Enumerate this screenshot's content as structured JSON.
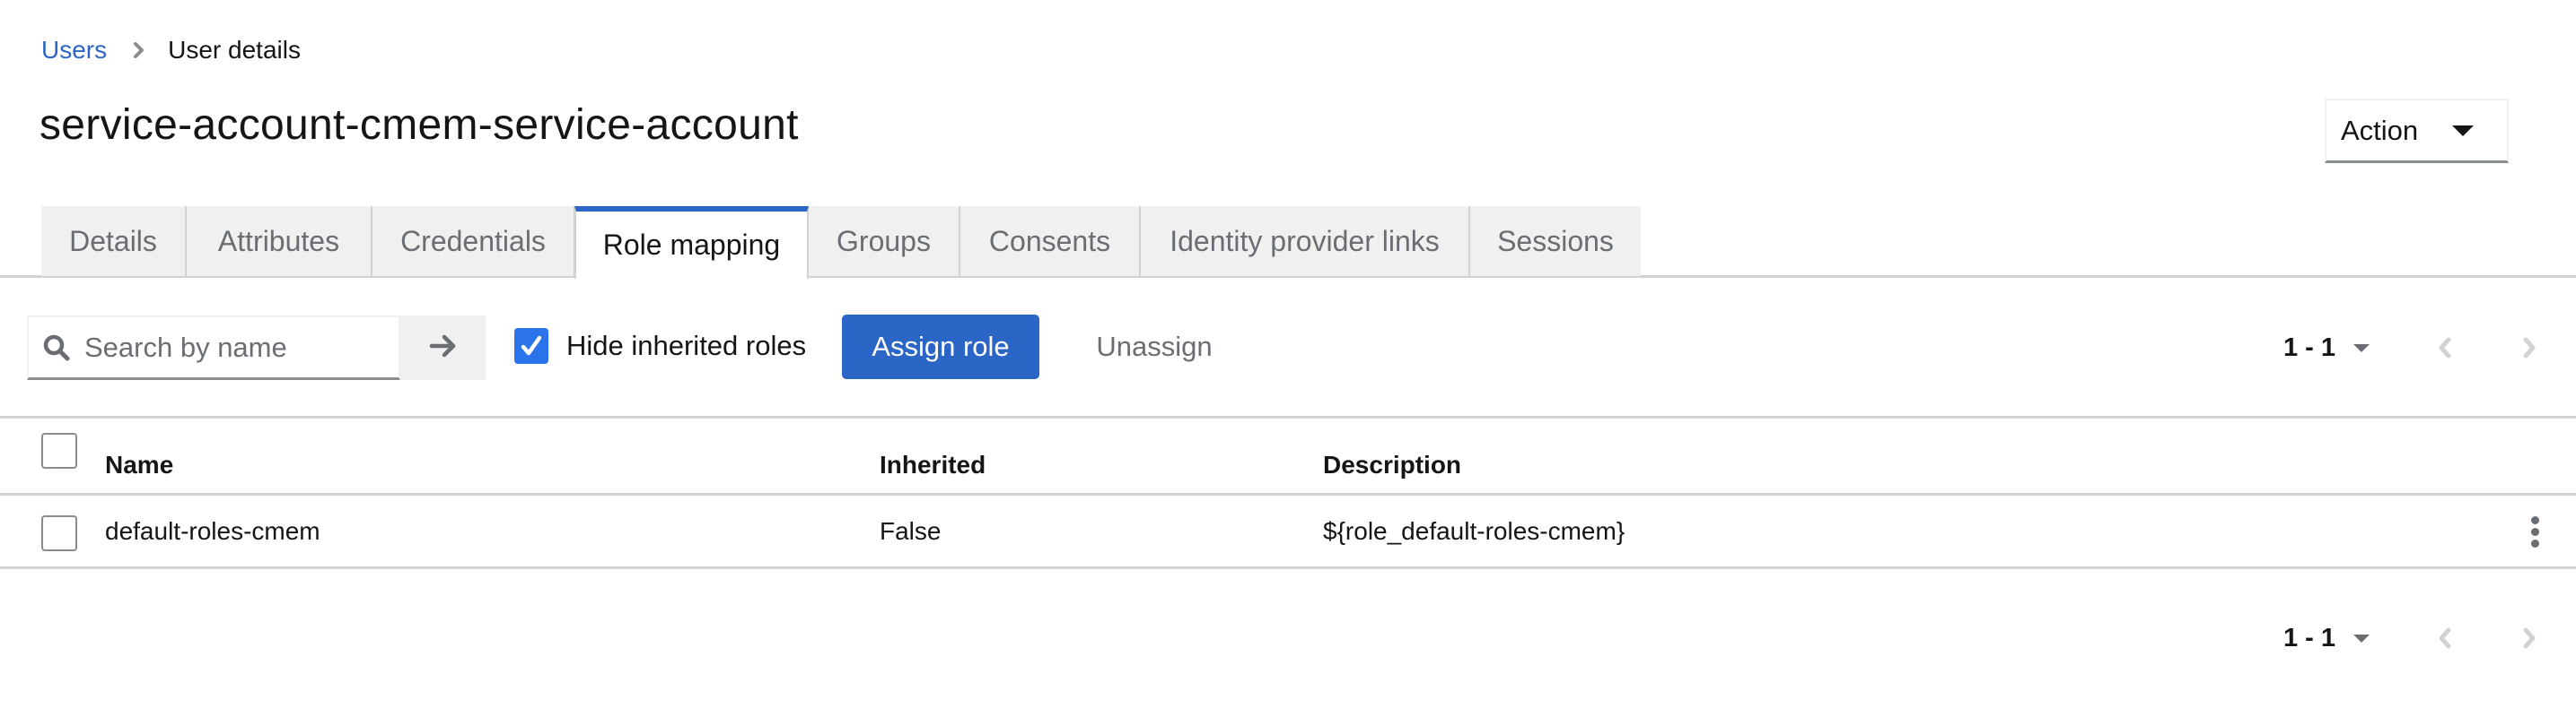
{
  "breadcrumb": {
    "items": [
      {
        "label": "Users",
        "link": true
      },
      {
        "label": "User details",
        "link": false
      }
    ]
  },
  "header": {
    "title": "service-account-cmem-service-account",
    "action_label": "Action"
  },
  "tabs": [
    {
      "label": "Details",
      "active": false
    },
    {
      "label": "Attributes",
      "active": false
    },
    {
      "label": "Credentials",
      "active": false
    },
    {
      "label": "Role mapping",
      "active": true
    },
    {
      "label": "Groups",
      "active": false
    },
    {
      "label": "Consents",
      "active": false
    },
    {
      "label": "Identity provider links",
      "active": false
    },
    {
      "label": "Sessions",
      "active": false
    }
  ],
  "toolbar": {
    "search_placeholder": "Search by name",
    "search_value": "",
    "hide_inherited_label": "Hide inherited roles",
    "hide_inherited_checked": true,
    "assign_label": "Assign role",
    "unassign_label": "Unassign"
  },
  "pagination_top": {
    "range": "1 - 1"
  },
  "pagination_bottom": {
    "range": "1 - 1"
  },
  "table": {
    "columns": [
      "Name",
      "Inherited",
      "Description"
    ],
    "rows": [
      {
        "name": "default-roles-cmem",
        "inherited": "False",
        "description": "${role_default-roles-cmem}",
        "selected": false
      }
    ]
  },
  "colors": {
    "primary": "#2b65c6",
    "checkbox": "#2b73eb",
    "tab_bg": "#f0f0f0",
    "border": "#d2d2d2",
    "muted_text": "#6a6e73"
  }
}
